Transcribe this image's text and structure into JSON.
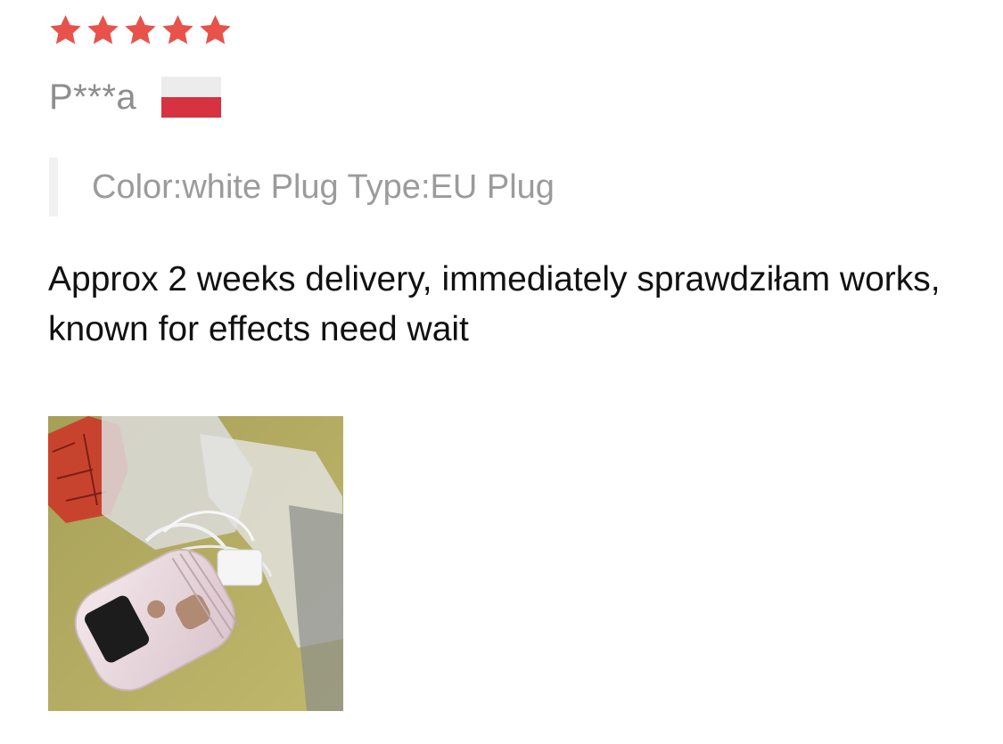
{
  "review": {
    "rating": 5,
    "max_rating": 5,
    "star_color": "#e8524a",
    "reviewer_name": "P***a",
    "country_flag": "poland-flag-icon",
    "sku": "Color:white Plug Type:EU Plug",
    "text": "Approx 2 weeks delivery, immediately sprawdziłam works, known for effects need wait",
    "photos": [
      "product-photo"
    ]
  }
}
